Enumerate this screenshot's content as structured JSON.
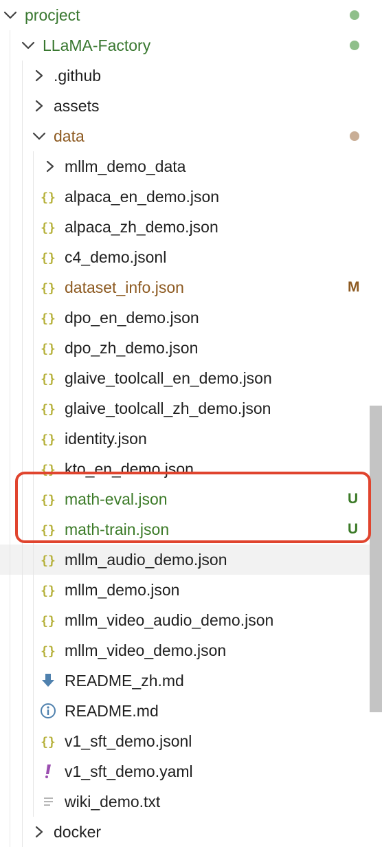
{
  "colors": {
    "git_added": "#3b7a27",
    "git_modified": "#8d5a21",
    "dot_green": "#8fbf8a",
    "dot_modified": "#c9ae96",
    "json_icon": "#b6b13b",
    "highlight_box": "#e0442e"
  },
  "explorer": {
    "rows": [
      {
        "label": "procject",
        "type": "folder",
        "expanded": true,
        "depth": 0,
        "status": "dot-green"
      },
      {
        "label": "LLaMA-Factory",
        "type": "folder",
        "expanded": true,
        "depth": 1,
        "status": "dot-green"
      },
      {
        "label": ".github",
        "type": "folder",
        "expanded": false,
        "depth": 2
      },
      {
        "label": "assets",
        "type": "folder",
        "expanded": false,
        "depth": 2
      },
      {
        "label": "data",
        "type": "folder",
        "expanded": true,
        "depth": 2,
        "status": "dot-modified"
      },
      {
        "label": "mllm_demo_data",
        "type": "folder",
        "expanded": false,
        "depth": 3
      },
      {
        "label": "alpaca_en_demo.json",
        "type": "json",
        "depth": 3
      },
      {
        "label": "alpaca_zh_demo.json",
        "type": "json",
        "depth": 3
      },
      {
        "label": "c4_demo.jsonl",
        "type": "json",
        "depth": 3
      },
      {
        "label": "dataset_info.json",
        "type": "json",
        "depth": 3,
        "status": "modified",
        "badge": "M"
      },
      {
        "label": "dpo_en_demo.json",
        "type": "json",
        "depth": 3
      },
      {
        "label": "dpo_zh_demo.json",
        "type": "json",
        "depth": 3
      },
      {
        "label": "glaive_toolcall_en_demo.json",
        "type": "json",
        "depth": 3
      },
      {
        "label": "glaive_toolcall_zh_demo.json",
        "type": "json",
        "depth": 3
      },
      {
        "label": "identity.json",
        "type": "json",
        "depth": 3
      },
      {
        "label": "kto_en_demo.json",
        "type": "json",
        "depth": 3
      },
      {
        "label": "math-eval.json",
        "type": "json",
        "depth": 3,
        "status": "untracked",
        "badge": "U"
      },
      {
        "label": "math-train.json",
        "type": "json",
        "depth": 3,
        "status": "untracked",
        "badge": "U"
      },
      {
        "label": "mllm_audio_demo.json",
        "type": "json",
        "depth": 3,
        "hover": true
      },
      {
        "label": "mllm_demo.json",
        "type": "json",
        "depth": 3
      },
      {
        "label": "mllm_video_audio_demo.json",
        "type": "json",
        "depth": 3
      },
      {
        "label": "mllm_video_demo.json",
        "type": "json",
        "depth": 3
      },
      {
        "label": "README_zh.md",
        "type": "markdown-download",
        "depth": 3
      },
      {
        "label": "README.md",
        "type": "markdown-info",
        "depth": 3
      },
      {
        "label": "v1_sft_demo.jsonl",
        "type": "json",
        "depth": 3
      },
      {
        "label": "v1_sft_demo.yaml",
        "type": "yaml",
        "depth": 3
      },
      {
        "label": "wiki_demo.txt",
        "type": "text",
        "depth": 3
      },
      {
        "label": "docker",
        "type": "folder",
        "expanded": false,
        "depth": 2
      }
    ]
  }
}
